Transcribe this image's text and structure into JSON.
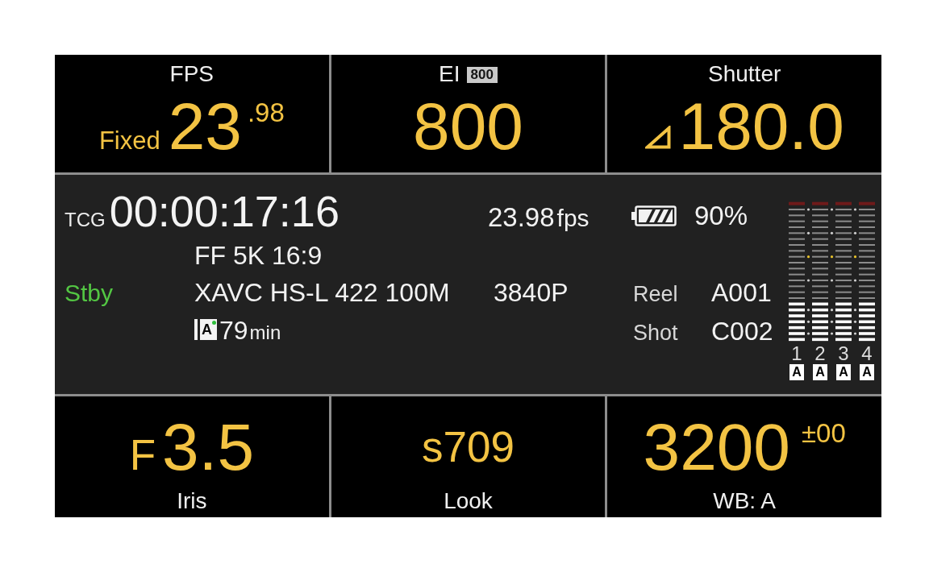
{
  "top_row": [
    {
      "kind": "fps",
      "label": "FPS",
      "prefix": "Fixed",
      "value": "23",
      "suffix": ".98"
    },
    {
      "kind": "ei",
      "label": "EI",
      "badge": "800",
      "value": "800"
    },
    {
      "kind": "shutter",
      "label": "Shutter",
      "value": "180.0"
    }
  ],
  "status_panel": {
    "timecode_label": "TCG",
    "timecode": "00:00:17:16",
    "frame_rate": "23.98",
    "frame_rate_unit": "fps",
    "battery": "90%",
    "imager_mode": "FF 5K 16:9",
    "record_state": "Stby",
    "codec": "XAVC HS-L 422 100M",
    "resolution": "3840P",
    "reel_label": "Reel",
    "reel": "A001",
    "media_slot": "A",
    "remaining": "79",
    "remaining_unit": "min",
    "shot_label": "Shot",
    "shot": "C002"
  },
  "audio_channels": [
    {
      "label": "1",
      "level": 0.3,
      "input": "A"
    },
    {
      "label": "2",
      "level": 0.3,
      "input": "A"
    },
    {
      "label": "3",
      "level": 0.3,
      "input": "A"
    },
    {
      "label": "4",
      "level": 0.3,
      "input": "A"
    }
  ],
  "bottom_row": [
    {
      "kind": "iris",
      "prefix": "F",
      "value": "3.5",
      "label": "Iris"
    },
    {
      "kind": "look",
      "value": "s709",
      "label": "Look"
    },
    {
      "kind": "wb",
      "value": "3200",
      "suffix": "±00",
      "label": "WB: A"
    }
  ]
}
